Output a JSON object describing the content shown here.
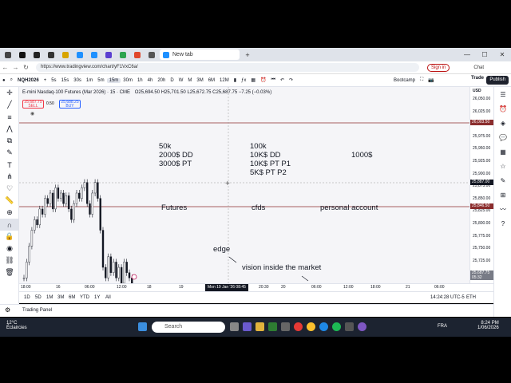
{
  "browser": {
    "active_tab_title": "New tab",
    "url": "https://www.tradingview.com/chart/yF1VxC6a/",
    "signin_label": "Sign in",
    "chat_label": "Chat"
  },
  "tv_toolbar": {
    "symbol": "NQH2026",
    "intervals": [
      "5s",
      "15s",
      "30s",
      "1m",
      "5m",
      "15m",
      "30m",
      "1h",
      "4h",
      "20h",
      "D",
      "W",
      "M",
      "3M",
      "6M",
      "12M"
    ],
    "selected_interval": "15m",
    "layout_name": "Bootcamp",
    "trade_label": "Trade",
    "publish_label": "Publish"
  },
  "legend": {
    "title": "E-mini Nasdaq-100 Futures (Mar 2026) · 15 · CME",
    "ohlc": "O25,694.50 H25,701.50 L25,672.75 C25,687.75 −7.25 (−0.03%)",
    "sell_price": "25,687.75",
    "sell_label": "SELL",
    "spread": "0.50",
    "buy_price": "25,688.25",
    "buy_label": "BUY"
  },
  "price_axis": {
    "currency": "USD",
    "labels": [
      "26,050.00",
      "26,025.00",
      "26,000.00",
      "25,975.00",
      "25,950.00",
      "25,925.00",
      "25,900.00",
      "25,875.00",
      "25,850.00",
      "25,825.00",
      "25,800.00",
      "25,775.00",
      "25,750.00",
      "25,725.00",
      "25,700.00"
    ],
    "tag_top": "26,003.50",
    "tag_cross": "25,887.00",
    "tag_mid": "25,846.50",
    "tag_last": "25,687.75",
    "tag_last_time": "05:32"
  },
  "time_axis": {
    "labels": [
      "18:00",
      "16",
      "06:00",
      "12:00",
      "18",
      "19",
      "20:30",
      "20",
      "06:00",
      "12:00",
      "18:00",
      "21",
      "06:00"
    ],
    "crosshair_time": "Mon 19 Jan '26   08:45"
  },
  "notes": {
    "col1": [
      "50k",
      "2000$ DD",
      "3000$ PT"
    ],
    "col2": [
      "100k",
      "10K$ DD",
      "10K$ PT P1",
      "5K$ PT P2"
    ],
    "col3": "1000$",
    "futures": "Futures",
    "cfds": "cfds",
    "personal": "personal account",
    "edge": "edge",
    "vision": "vision inside the market"
  },
  "bottom_bar": {
    "ranges": [
      "1D",
      "5D",
      "1M",
      "3M",
      "6M",
      "YTD",
      "1Y",
      "All"
    ],
    "clock": "14:24:28 UTC-5",
    "session": "ETH",
    "trading_panel": "Trading Panel"
  },
  "taskbar": {
    "weather_temp": "12°C",
    "weather_desc": "Éclaircies",
    "search_placeholder": "Search",
    "lang": "FRA",
    "time": "8:24 PM",
    "date": "1/06/2026"
  },
  "chart_data": {
    "type": "candlestick",
    "price_range": [
      25690,
      26060
    ],
    "series": [
      {
        "name": "NQH2026",
        "values": [
          25700,
          25730,
          25760,
          25790,
          25810,
          25800,
          25830,
          25820,
          25850,
          25840,
          25860,
          25830,
          25870,
          25850,
          25860,
          25840,
          25855,
          25830,
          25810,
          25840,
          25860,
          25850,
          25870,
          25880,
          25840,
          25820,
          25860,
          25880,
          25850,
          25790,
          25720,
          25700,
          25740,
          25710,
          25730,
          25700,
          25720,
          25690,
          25730,
          25710,
          25700,
          25688
        ]
      }
    ]
  }
}
